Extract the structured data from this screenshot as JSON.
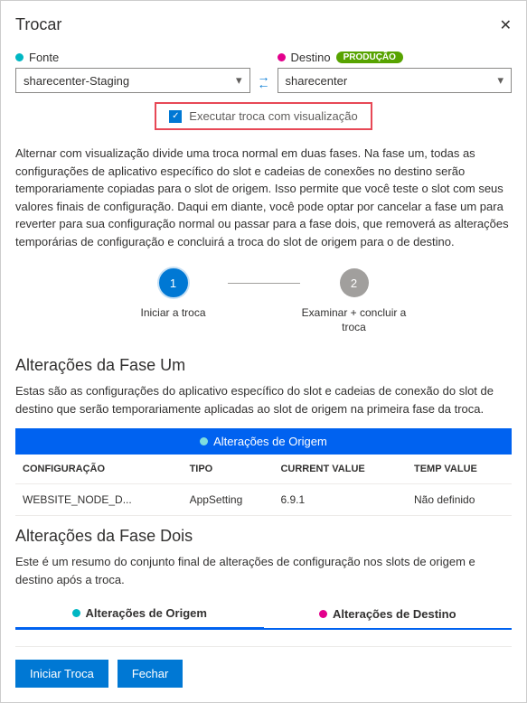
{
  "header": {
    "title": "Trocar"
  },
  "source": {
    "label": "Fonte",
    "value": "sharecenter-Staging"
  },
  "destination": {
    "label": "Destino",
    "badge": "PRODUÇÃO",
    "value": "sharecenter"
  },
  "preview": {
    "label": "Executar troca com visualização"
  },
  "description": "Alternar com visualização divide uma troca normal em duas fases. Na fase um, todas as configurações de aplicativo específico do slot e cadeias de conexões no destino serão temporariamente copiadas para o slot de origem. Isso permite que você teste o slot com seus valores finais de configuração. Daqui em diante, você pode optar por cancelar a fase um para reverter para sua configuração normal ou passar para a fase dois, que removerá as alterações temporárias de configuração e concluirá a troca do slot de origem para o de destino.",
  "steps": {
    "one": {
      "num": "1",
      "label": "Iniciar a troca"
    },
    "two": {
      "num": "2",
      "label": "Examinar + concluir a troca"
    }
  },
  "phase1": {
    "title": "Alterações da Fase Um",
    "desc": "Estas são as configurações do aplicativo específico do slot e cadeias de conexão do slot de destino que serão temporariamente aplicadas ao slot de origem na primeira fase da troca.",
    "tableHeader": "Alterações de Origem",
    "cols": {
      "c1": "CONFIGURAÇÃO",
      "c2": "TIPO",
      "c3": "CURRENT VALUE",
      "c4": "TEMP VALUE"
    },
    "row": {
      "c1": "WEBSITE_NODE_D...",
      "c2": "AppSetting",
      "c3": "6.9.1",
      "c4": "Não definido"
    }
  },
  "phase2": {
    "title": "Alterações da Fase Dois",
    "desc": "Este é um resumo do conjunto final de alterações de configuração nos slots de origem e destino após a troca.",
    "tab1": "Alterações de Origem",
    "tab2": "Alterações de Destino"
  },
  "footer": {
    "start": "Iniciar Troca",
    "close": "Fechar"
  }
}
